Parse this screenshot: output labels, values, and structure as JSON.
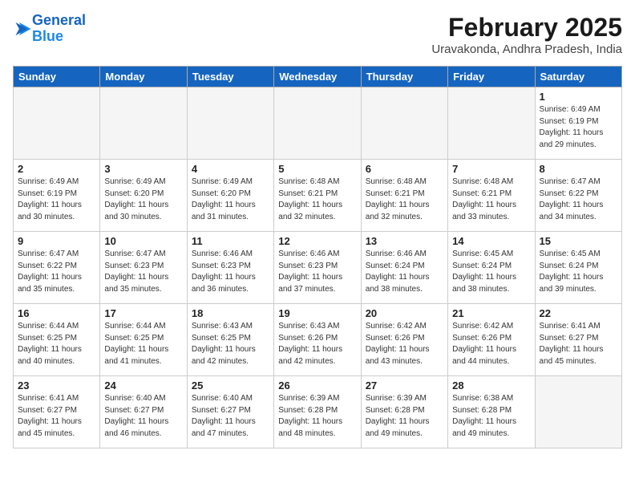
{
  "header": {
    "logo_line1": "General",
    "logo_line2": "Blue",
    "month_title": "February 2025",
    "location": "Uravakonda, Andhra Pradesh, India"
  },
  "weekdays": [
    "Sunday",
    "Monday",
    "Tuesday",
    "Wednesday",
    "Thursday",
    "Friday",
    "Saturday"
  ],
  "weeks": [
    [
      {
        "day": "",
        "info": ""
      },
      {
        "day": "",
        "info": ""
      },
      {
        "day": "",
        "info": ""
      },
      {
        "day": "",
        "info": ""
      },
      {
        "day": "",
        "info": ""
      },
      {
        "day": "",
        "info": ""
      },
      {
        "day": "1",
        "info": "Sunrise: 6:49 AM\nSunset: 6:19 PM\nDaylight: 11 hours\nand 29 minutes."
      }
    ],
    [
      {
        "day": "2",
        "info": "Sunrise: 6:49 AM\nSunset: 6:19 PM\nDaylight: 11 hours\nand 30 minutes."
      },
      {
        "day": "3",
        "info": "Sunrise: 6:49 AM\nSunset: 6:20 PM\nDaylight: 11 hours\nand 30 minutes."
      },
      {
        "day": "4",
        "info": "Sunrise: 6:49 AM\nSunset: 6:20 PM\nDaylight: 11 hours\nand 31 minutes."
      },
      {
        "day": "5",
        "info": "Sunrise: 6:48 AM\nSunset: 6:21 PM\nDaylight: 11 hours\nand 32 minutes."
      },
      {
        "day": "6",
        "info": "Sunrise: 6:48 AM\nSunset: 6:21 PM\nDaylight: 11 hours\nand 32 minutes."
      },
      {
        "day": "7",
        "info": "Sunrise: 6:48 AM\nSunset: 6:21 PM\nDaylight: 11 hours\nand 33 minutes."
      },
      {
        "day": "8",
        "info": "Sunrise: 6:47 AM\nSunset: 6:22 PM\nDaylight: 11 hours\nand 34 minutes."
      }
    ],
    [
      {
        "day": "9",
        "info": "Sunrise: 6:47 AM\nSunset: 6:22 PM\nDaylight: 11 hours\nand 35 minutes."
      },
      {
        "day": "10",
        "info": "Sunrise: 6:47 AM\nSunset: 6:23 PM\nDaylight: 11 hours\nand 35 minutes."
      },
      {
        "day": "11",
        "info": "Sunrise: 6:46 AM\nSunset: 6:23 PM\nDaylight: 11 hours\nand 36 minutes."
      },
      {
        "day": "12",
        "info": "Sunrise: 6:46 AM\nSunset: 6:23 PM\nDaylight: 11 hours\nand 37 minutes."
      },
      {
        "day": "13",
        "info": "Sunrise: 6:46 AM\nSunset: 6:24 PM\nDaylight: 11 hours\nand 38 minutes."
      },
      {
        "day": "14",
        "info": "Sunrise: 6:45 AM\nSunset: 6:24 PM\nDaylight: 11 hours\nand 38 minutes."
      },
      {
        "day": "15",
        "info": "Sunrise: 6:45 AM\nSunset: 6:24 PM\nDaylight: 11 hours\nand 39 minutes."
      }
    ],
    [
      {
        "day": "16",
        "info": "Sunrise: 6:44 AM\nSunset: 6:25 PM\nDaylight: 11 hours\nand 40 minutes."
      },
      {
        "day": "17",
        "info": "Sunrise: 6:44 AM\nSunset: 6:25 PM\nDaylight: 11 hours\nand 41 minutes."
      },
      {
        "day": "18",
        "info": "Sunrise: 6:43 AM\nSunset: 6:25 PM\nDaylight: 11 hours\nand 42 minutes."
      },
      {
        "day": "19",
        "info": "Sunrise: 6:43 AM\nSunset: 6:26 PM\nDaylight: 11 hours\nand 42 minutes."
      },
      {
        "day": "20",
        "info": "Sunrise: 6:42 AM\nSunset: 6:26 PM\nDaylight: 11 hours\nand 43 minutes."
      },
      {
        "day": "21",
        "info": "Sunrise: 6:42 AM\nSunset: 6:26 PM\nDaylight: 11 hours\nand 44 minutes."
      },
      {
        "day": "22",
        "info": "Sunrise: 6:41 AM\nSunset: 6:27 PM\nDaylight: 11 hours\nand 45 minutes."
      }
    ],
    [
      {
        "day": "23",
        "info": "Sunrise: 6:41 AM\nSunset: 6:27 PM\nDaylight: 11 hours\nand 45 minutes."
      },
      {
        "day": "24",
        "info": "Sunrise: 6:40 AM\nSunset: 6:27 PM\nDaylight: 11 hours\nand 46 minutes."
      },
      {
        "day": "25",
        "info": "Sunrise: 6:40 AM\nSunset: 6:27 PM\nDaylight: 11 hours\nand 47 minutes."
      },
      {
        "day": "26",
        "info": "Sunrise: 6:39 AM\nSunset: 6:28 PM\nDaylight: 11 hours\nand 48 minutes."
      },
      {
        "day": "27",
        "info": "Sunrise: 6:39 AM\nSunset: 6:28 PM\nDaylight: 11 hours\nand 49 minutes."
      },
      {
        "day": "28",
        "info": "Sunrise: 6:38 AM\nSunset: 6:28 PM\nDaylight: 11 hours\nand 49 minutes."
      },
      {
        "day": "",
        "info": ""
      }
    ]
  ]
}
